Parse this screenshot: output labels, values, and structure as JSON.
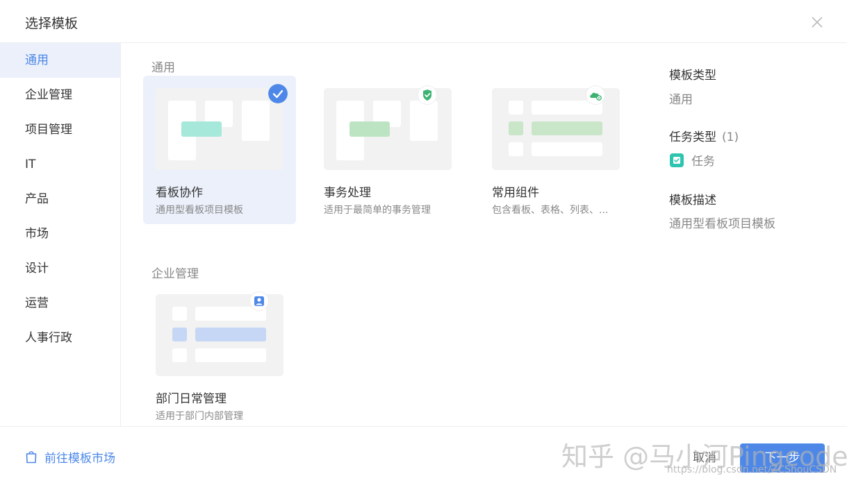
{
  "dialog": {
    "title": "选择模板",
    "close_icon": "close-icon"
  },
  "sidebar": {
    "items": [
      {
        "label": "通用",
        "active": true
      },
      {
        "label": "企业管理"
      },
      {
        "label": "项目管理"
      },
      {
        "label": "IT"
      },
      {
        "label": "产品"
      },
      {
        "label": "市场"
      },
      {
        "label": "设计"
      },
      {
        "label": "运营"
      },
      {
        "label": "人事行政"
      }
    ]
  },
  "sections": [
    {
      "title": "通用",
      "cards": [
        {
          "name": "看板协作",
          "desc": "通用型看板项目模板",
          "selected": true,
          "badge_icon": "check-circle-icon",
          "accent": "#a6e8da"
        },
        {
          "name": "事务处理",
          "desc": "适用于最简单的事务管理",
          "badge_icon": "shield-check-icon",
          "accent": "#bde4c2"
        },
        {
          "name": "常用组件",
          "desc": "包含看板、表格、列表、...",
          "badge_icon": "cloud-gear-icon",
          "accent": "#c9e6c9"
        }
      ]
    },
    {
      "title": "企业管理",
      "cards": [
        {
          "name": "部门日常管理",
          "desc": "适用于部门内部管理",
          "badge_icon": "user-icon",
          "accent": "#c5d7f5"
        }
      ]
    }
  ],
  "details": {
    "type_label": "模板类型",
    "type_value": "通用",
    "task_label": "任务类型",
    "task_count": "(1)",
    "task_item": "任务",
    "desc_label": "模板描述",
    "desc_value": "通用型看板项目模板"
  },
  "footer": {
    "market_link": "前往模板市场",
    "cancel": "取消",
    "next": "下一步",
    "watermark": "知乎 @马小河Pingcode",
    "url_watermark": "https://blog.csdn.net/ZCShouCSDN"
  },
  "colors": {
    "accent": "#4d88e8",
    "selected_bg": "#ebf0fb",
    "task_icon": "#2ec5b0"
  }
}
